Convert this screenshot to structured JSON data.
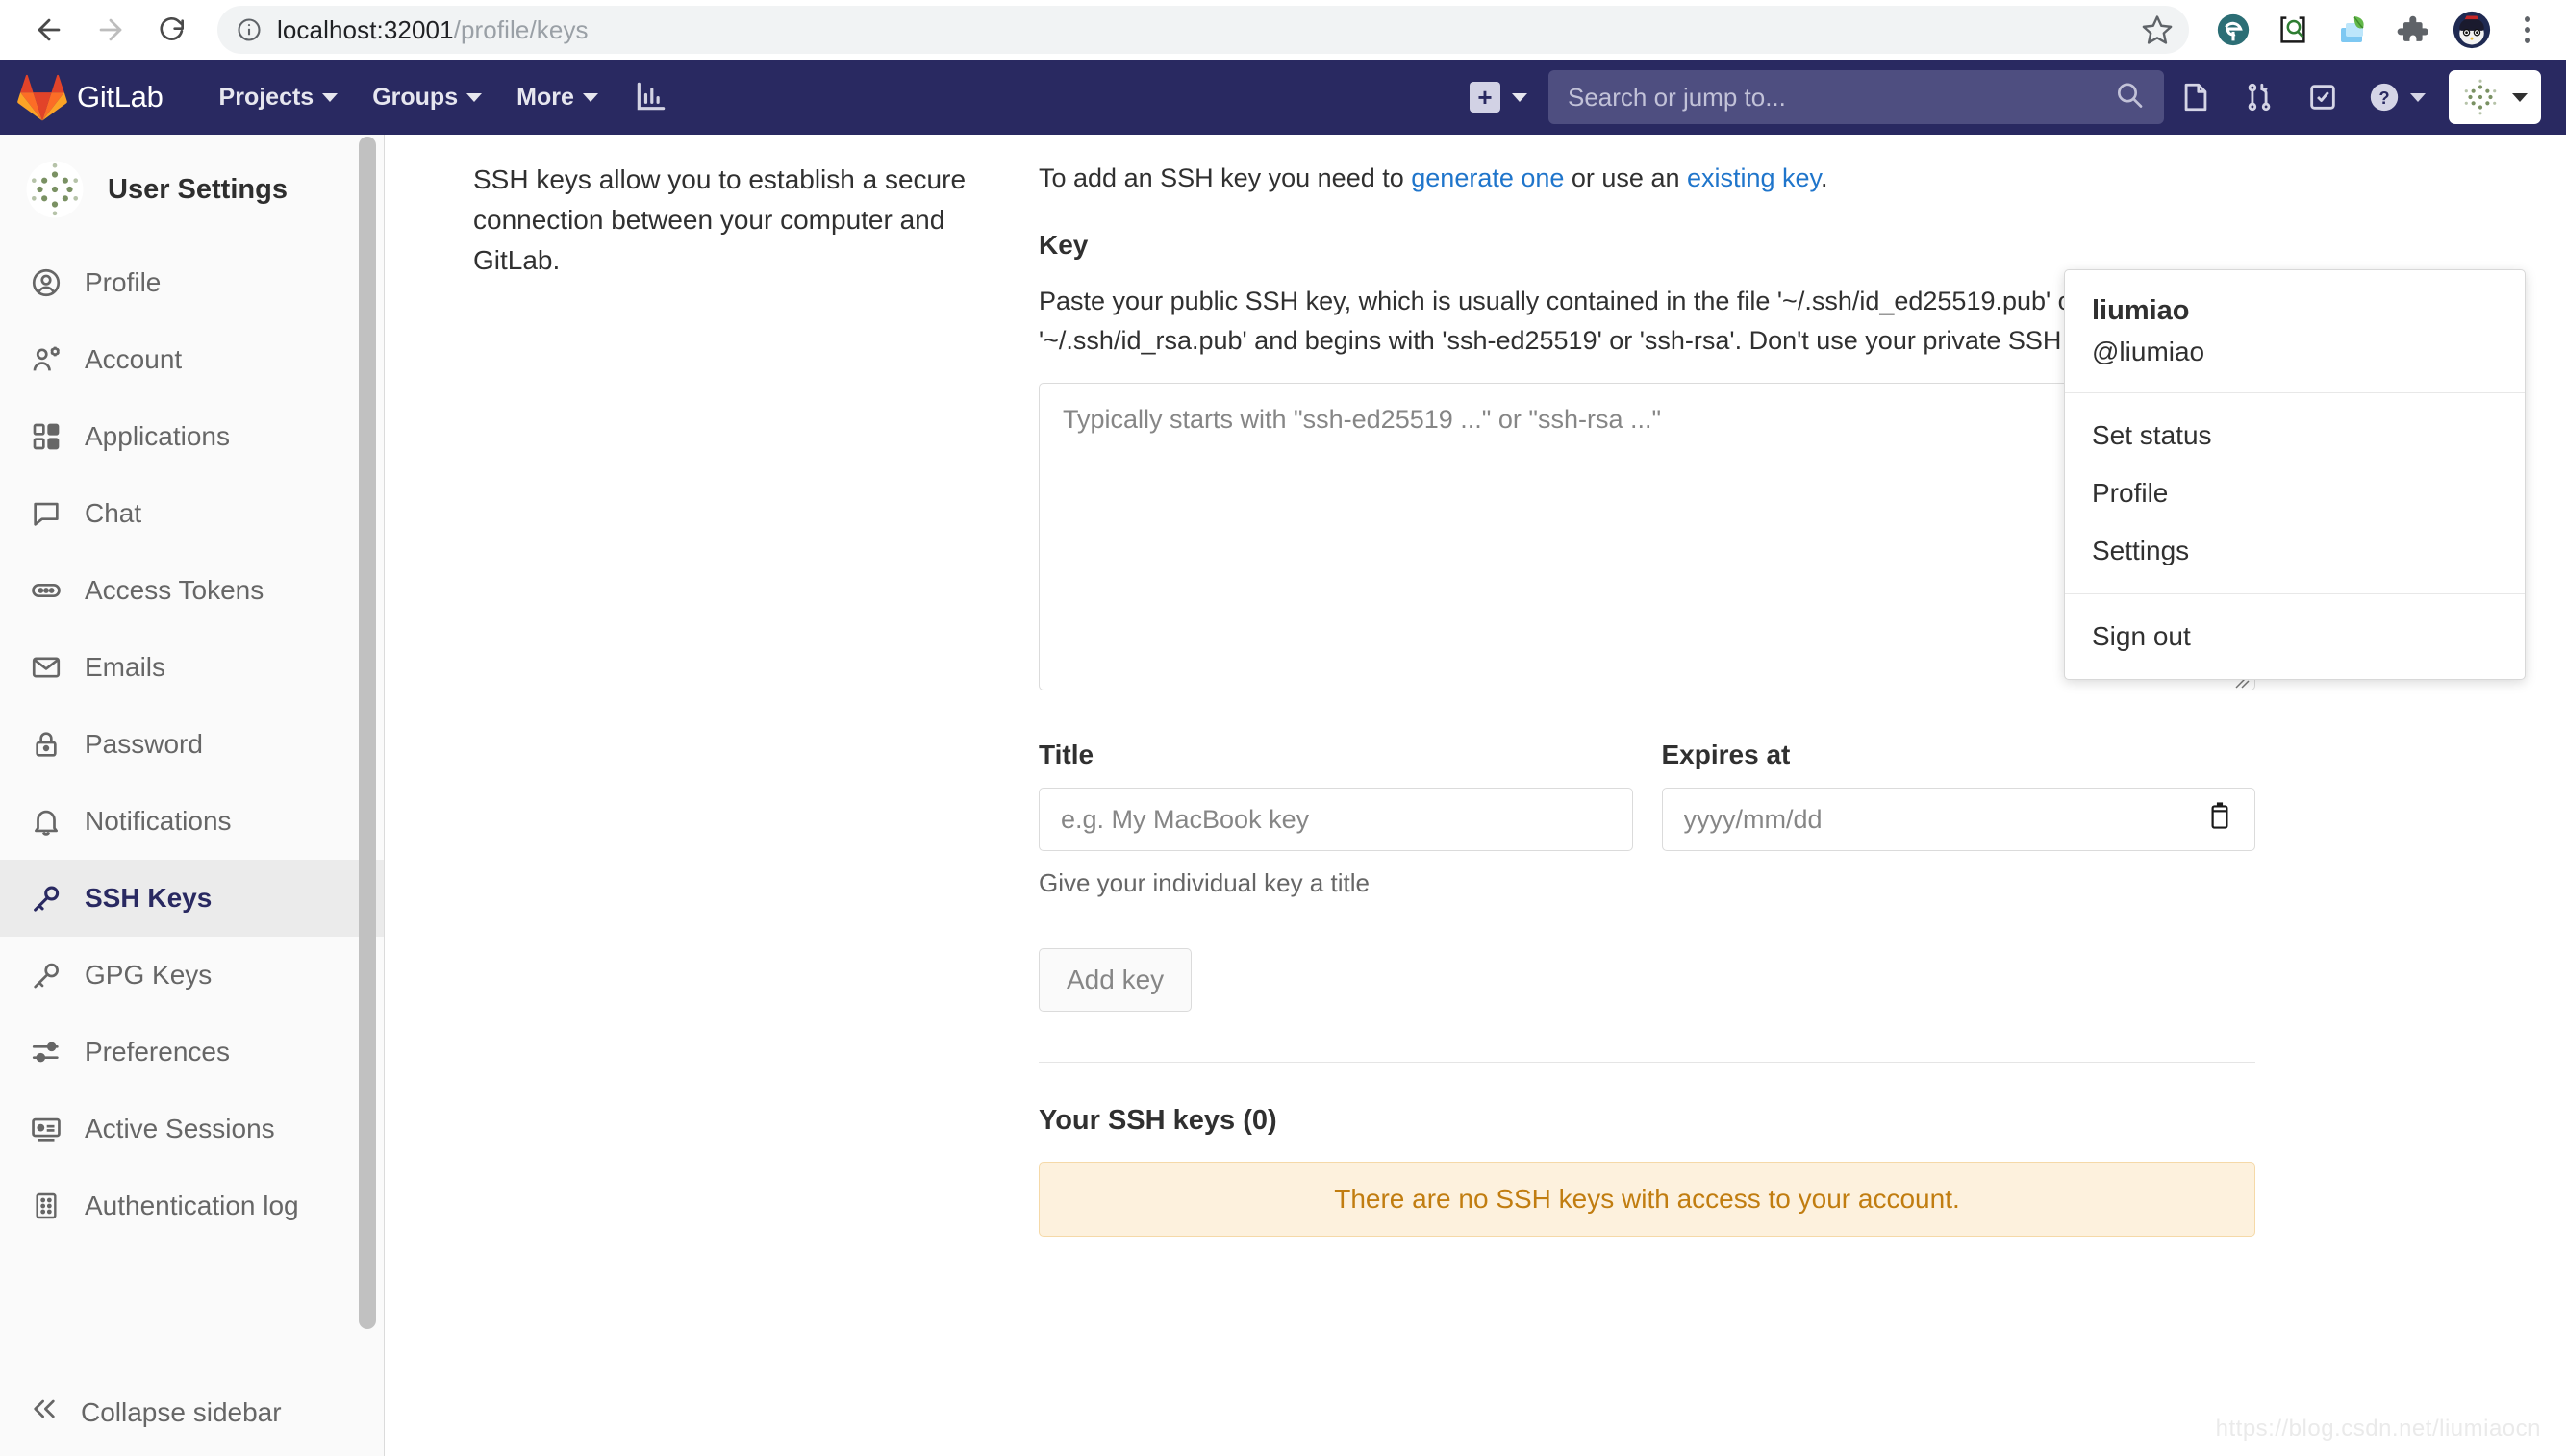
{
  "browser": {
    "url_host": "localhost:32001",
    "url_path": "/profile/keys",
    "back_icon": "back-arrow-icon",
    "forward_icon": "forward-arrow-icon",
    "reload_icon": "reload-icon",
    "info_icon": "info-circle-icon",
    "bookmark_icon": "star-icon",
    "extensions": [
      "edge-extension-icon",
      "search-extension-icon",
      "leaf-extension-icon",
      "puzzle-extensions-icon"
    ],
    "profile_icon": "browser-profile-avatar",
    "menu_icon": "three-dots-menu-icon"
  },
  "navbar": {
    "brand": "GitLab",
    "links": [
      {
        "label": "Projects"
      },
      {
        "label": "Groups"
      },
      {
        "label": "More"
      }
    ],
    "chart_icon": "analytics-chart-icon",
    "plus_label": "+",
    "search_placeholder": "Search or jump to...",
    "search_value": "",
    "icons": [
      {
        "name": "issues-icon"
      },
      {
        "name": "merge-requests-icon"
      },
      {
        "name": "todos-icon"
      },
      {
        "name": "help-icon"
      }
    ],
    "avatar_icon": "user-avatar"
  },
  "sidebar": {
    "title": "User Settings",
    "avatar_icon": "user-avatar",
    "items": [
      {
        "label": "Profile",
        "icon": "profile-icon",
        "active": false
      },
      {
        "label": "Account",
        "icon": "account-icon",
        "active": false
      },
      {
        "label": "Applications",
        "icon": "applications-icon",
        "active": false
      },
      {
        "label": "Chat",
        "icon": "chat-icon",
        "active": false
      },
      {
        "label": "Access Tokens",
        "icon": "access-tokens-icon",
        "active": false
      },
      {
        "label": "Emails",
        "icon": "email-icon",
        "active": false
      },
      {
        "label": "Password",
        "icon": "lock-icon",
        "active": false
      },
      {
        "label": "Notifications",
        "icon": "bell-icon",
        "active": false
      },
      {
        "label": "SSH Keys",
        "icon": "key-icon",
        "active": true
      },
      {
        "label": "GPG Keys",
        "icon": "key-icon",
        "active": false
      },
      {
        "label": "Preferences",
        "icon": "preferences-icon",
        "active": false
      },
      {
        "label": "Active Sessions",
        "icon": "monitor-icon",
        "active": false
      },
      {
        "label": "Authentication log",
        "icon": "log-icon",
        "active": false
      }
    ],
    "collapse_label": "Collapse sidebar",
    "collapse_icon": "chevron-double-left-icon"
  },
  "main": {
    "left_description": "SSH keys allow you to establish a secure connection between your computer and GitLab.",
    "lead_prefix": "To add an SSH key you need to ",
    "lead_link1": "generate one",
    "lead_middle": " or use an ",
    "lead_link2": "existing key",
    "lead_suffix": ".",
    "key_label": "Key",
    "key_help": "Paste your public SSH key, which is usually contained in the file '~/.ssh/id_ed25519.pub' or '~/.ssh/id_rsa.pub' and begins with 'ssh-ed25519' or 'ssh-rsa'. Don't use your private SSH key.",
    "key_placeholder": "Typically starts with \"ssh-ed25519 ...\" or \"ssh-rsa ...\"",
    "key_value": "",
    "title_label": "Title",
    "title_placeholder": "e.g. My MacBook key",
    "title_value": "",
    "title_hint": "Give your individual key a title",
    "expires_label": "Expires at",
    "expires_placeholder": "yyyy/mm/dd",
    "expires_value": "",
    "calendar_icon": "calendar-icon",
    "add_key_label": "Add key",
    "keys_section_title": "Your SSH keys (0)",
    "empty_alert": "There are no SSH keys with access to your account."
  },
  "user_dropdown": {
    "name": "liumiao",
    "handle": "@liumiao",
    "items_group1": [
      {
        "label": "Set status"
      },
      {
        "label": "Profile"
      },
      {
        "label": "Settings"
      }
    ],
    "items_group2": [
      {
        "label": "Sign out"
      }
    ]
  },
  "watermark": "https://blog.csdn.net/liumiaocn",
  "colors": {
    "navbar_bg": "#292961",
    "accent": "#292961",
    "link": "#1f75cb",
    "warning_text": "#c17d10",
    "warning_bg": "#fdf1dd"
  }
}
